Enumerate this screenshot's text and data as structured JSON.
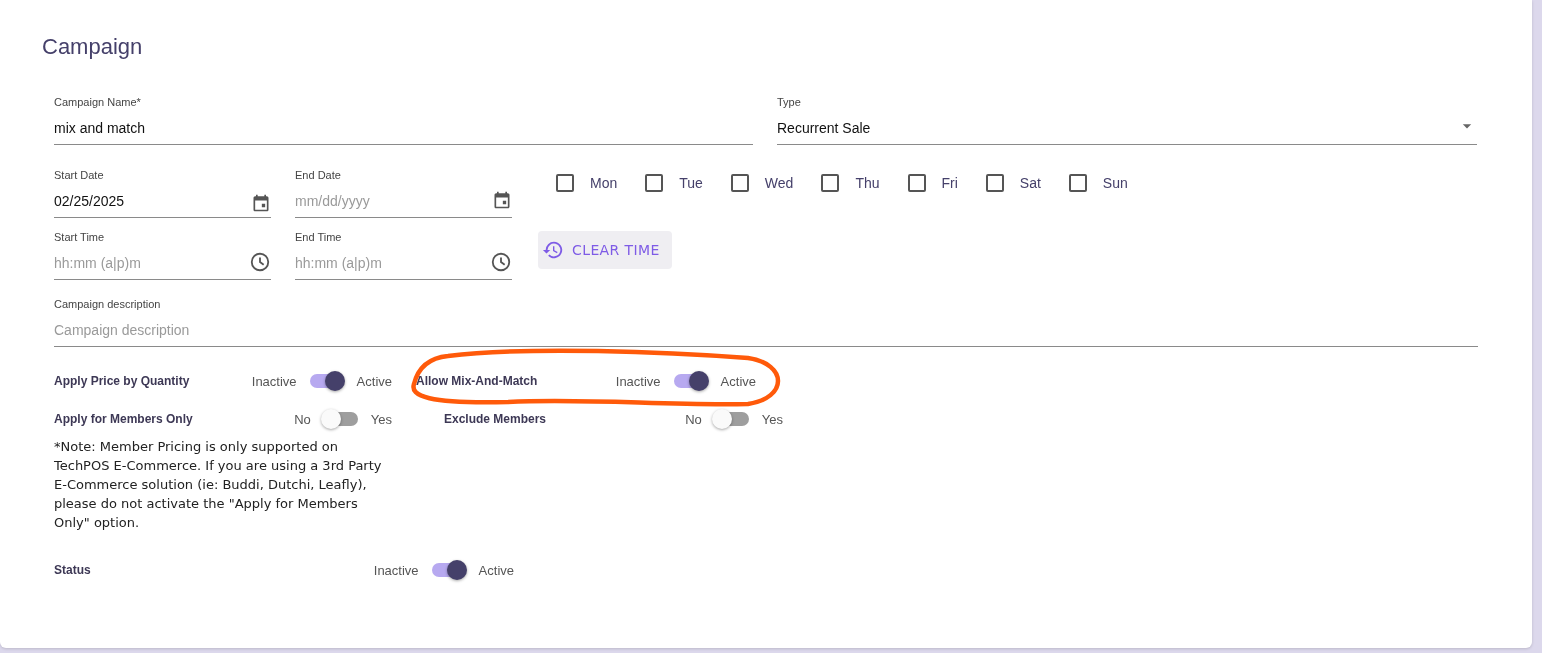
{
  "title": "Campaign",
  "campaign_name": {
    "label": "Campaign Name",
    "required_mark": "*",
    "value": "mix and match"
  },
  "type": {
    "label": "Type",
    "value": "Recurrent Sale"
  },
  "start_date": {
    "label": "Start Date",
    "value": "02/25/2025"
  },
  "end_date": {
    "label": "End Date",
    "placeholder": "mm/dd/yyyy"
  },
  "days": [
    {
      "label": "Mon",
      "checked": false
    },
    {
      "label": "Tue",
      "checked": false
    },
    {
      "label": "Wed",
      "checked": false
    },
    {
      "label": "Thu",
      "checked": false
    },
    {
      "label": "Fri",
      "checked": false
    },
    {
      "label": "Sat",
      "checked": false
    },
    {
      "label": "Sun",
      "checked": false
    }
  ],
  "start_time": {
    "label": "Start Time",
    "placeholder": "hh:mm (a|p)m"
  },
  "end_time": {
    "label": "End Time",
    "placeholder": "hh:mm (a|p)m"
  },
  "clear_time_button": "CLEAR TIME",
  "description": {
    "label": "Campaign description",
    "placeholder": "Campaign description"
  },
  "toggles": [
    {
      "label": "Apply Price by Quantity",
      "off_text": "Inactive",
      "on_text": "Active",
      "on": true
    },
    {
      "label": "Allow Mix-And-Match",
      "off_text": "Inactive",
      "on_text": "Active",
      "on": true
    },
    {
      "label": "Apply for Members Only",
      "off_text": "No",
      "on_text": "Yes",
      "on": false
    },
    {
      "label": "Exclude Members",
      "off_text": "No",
      "on_text": "Yes",
      "on": false
    }
  ],
  "note": "*Note: Member Pricing is only supported on TechPOS E-Commerce. If you are using a 3rd Party E-Commerce solution (ie: Buddi, Dutchi, Leafly), please do not activate the \"Apply for Members Only\" option.",
  "status": {
    "label": "Status",
    "off_text": "Inactive",
    "on_text": "Active",
    "on": true
  }
}
